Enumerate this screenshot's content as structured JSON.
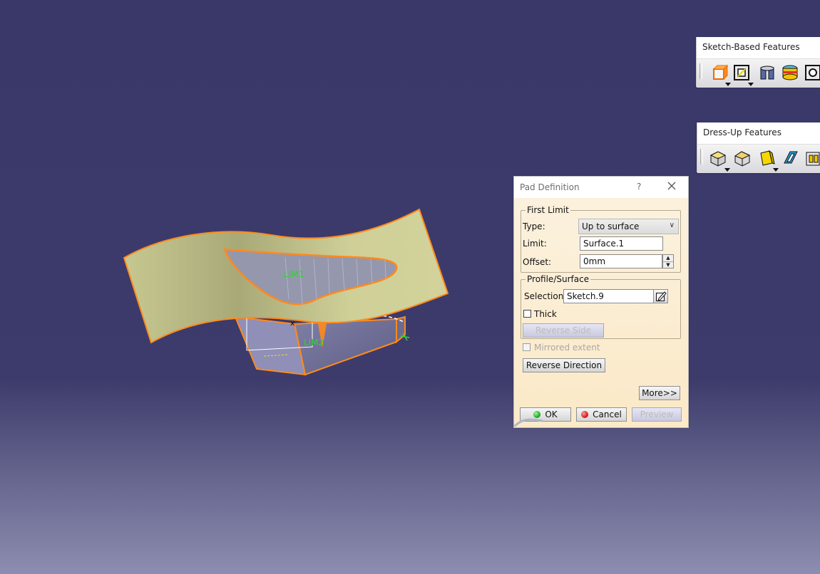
{
  "toolbars": {
    "sketch": {
      "title": "Sketch-Based Features",
      "tools": [
        "pad-icon",
        "pocket-icon",
        "shaft-icon",
        "groove-icon",
        "hole-icon"
      ]
    },
    "dressup": {
      "title": "Dress-Up Features",
      "tools": [
        "edge-fillet-icon",
        "chamfer-icon",
        "draft-icon",
        "shell-icon",
        "thickness-icon"
      ]
    }
  },
  "model": {
    "labels": {
      "lim1": "LIM1",
      "lim2": "LIM2"
    }
  },
  "dialog": {
    "title": "Pad Definition",
    "help": "?",
    "first_limit": {
      "legend": "First Limit",
      "type_label": "Type:",
      "type_value": "Up to surface",
      "limit_label": "Limit:",
      "limit_value": "Surface.1",
      "offset_label": "Offset:",
      "offset_value": "0mm"
    },
    "profile": {
      "legend": "Profile/Surface",
      "selection_label": "Selection:",
      "selection_value": "Sketch.9",
      "thick_label": "Thick",
      "reverse_side": "Reverse Side"
    },
    "mirrored_extent": "Mirrored extent",
    "reverse_direction": "Reverse Direction",
    "more": "More>>",
    "ok": "OK",
    "cancel": "Cancel",
    "preview": "Preview"
  },
  "colors": {
    "background_top": "#3a3868",
    "background_bottom": "#8d8db0",
    "surface": "#c8c88e",
    "edge_highlight": "#ff8a1c",
    "label_green": "#22dd22"
  }
}
